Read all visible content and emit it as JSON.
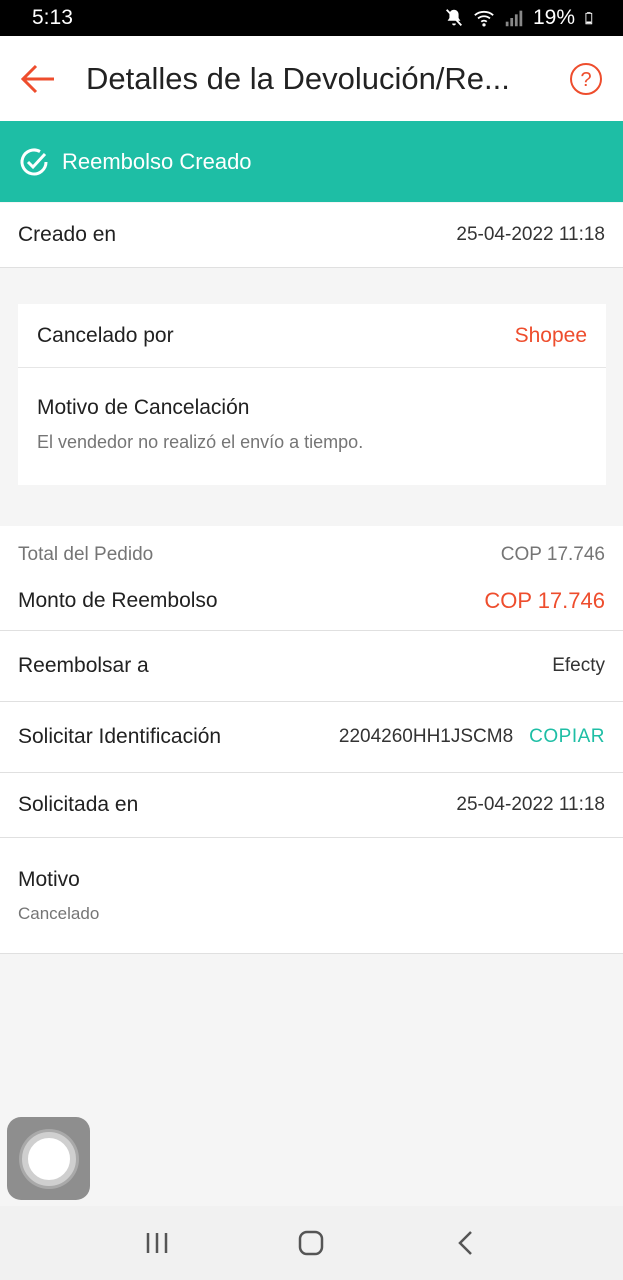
{
  "statusbar": {
    "time": "5:13",
    "battery": "19%"
  },
  "appbar": {
    "title": "Detalles de la Devolución/Re..."
  },
  "banner": {
    "text": "Reembolso Creado"
  },
  "created": {
    "label": "Creado en",
    "value": "25-04-2022 11:18"
  },
  "cancel_card": {
    "by_label": "Cancelado por",
    "by_value": "Shopee",
    "reason_label": "Motivo de Cancelación",
    "reason_value": "El vendedor no realizó el envío a tiempo."
  },
  "summary": {
    "order_total_label": "Total del Pedido",
    "order_total_value": "COP 17.746",
    "refund_amount_label": "Monto de Reembolso",
    "refund_amount_value": "COP 17.746"
  },
  "refund_to": {
    "label": "Reembolsar a",
    "value": "Efecty"
  },
  "request_id": {
    "label": "Solicitar Identificación",
    "value": "2204260HH1JSCM8",
    "copy_label": "COPIAR"
  },
  "requested_at": {
    "label": "Solicitada en",
    "value": "25-04-2022 11:18"
  },
  "reason": {
    "label": "Motivo",
    "value": "Cancelado"
  },
  "colors": {
    "accent": "#ee4d2d",
    "teal": "#1ebea5"
  }
}
